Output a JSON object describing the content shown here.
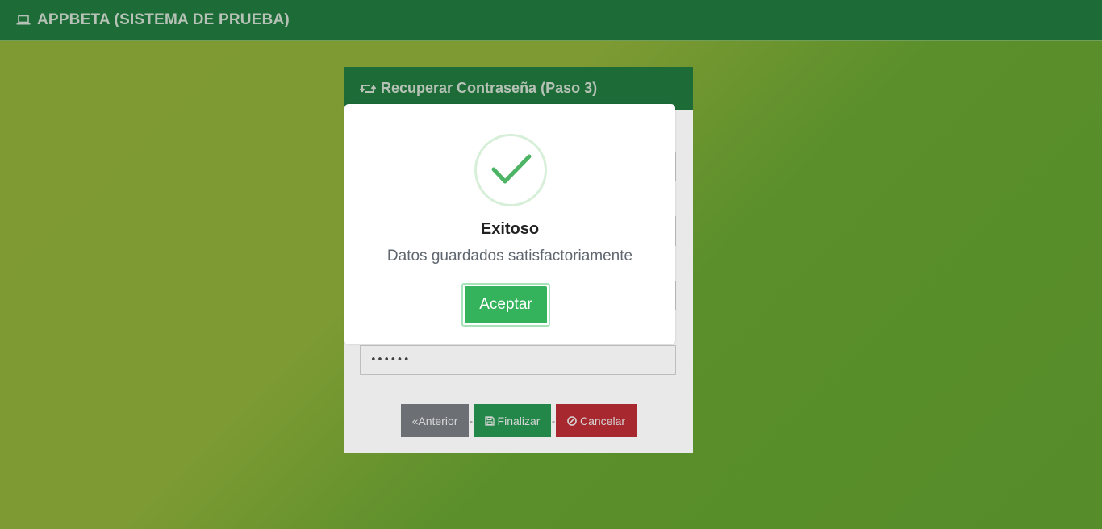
{
  "topbar": {
    "brand": "APPBETA (SISTEMA DE PRUEBA)",
    "icon": "laptop-icon"
  },
  "card": {
    "title": "Recuperar Contraseña (Paso 3)",
    "icon": "retweet-icon",
    "password_value": "••••••",
    "buttons": {
      "previous": "«Anterior",
      "finish": "Finalizar",
      "cancel": "Cancelar",
      "separator": "-"
    }
  },
  "modal": {
    "icon": "success-check-icon",
    "title": "Exitoso",
    "message": "Datos guardados satisfactoriamente",
    "accept": "Aceptar"
  },
  "colors": {
    "header": "#1d6c38",
    "success": "#34b35c",
    "danger": "#a8282f",
    "secondary": "#6c6f74"
  }
}
